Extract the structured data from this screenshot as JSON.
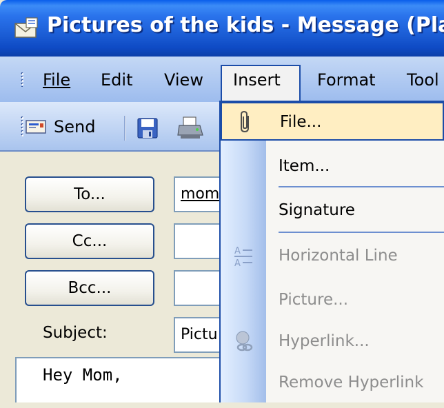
{
  "window": {
    "title": "Pictures of the kids - Message (Plai",
    "title_icon": "envelope-icon"
  },
  "menubar": {
    "items": [
      {
        "label": "File",
        "underline_char": "F"
      },
      {
        "label": "Edit",
        "underline_char": "E"
      },
      {
        "label": "View",
        "underline_char": "V"
      },
      {
        "label": "Insert",
        "underline_char": "I",
        "active": true
      },
      {
        "label": "Format",
        "underline_char": "o"
      },
      {
        "label": "Tool",
        "underline_char": "T"
      }
    ]
  },
  "toolbar": {
    "send_label": "Send",
    "send_icon": "send-envelope-icon",
    "save_icon": "save-icon",
    "print_icon": "print-icon"
  },
  "form": {
    "to_button": "To...",
    "cc_button": "Cc...",
    "bcc_button": "Bcc...",
    "to_value": "mom",
    "cc_value": "",
    "bcc_value": "",
    "subject_label": "Subject:",
    "subject_value": "Pictu",
    "body_text": "Hey Mom,"
  },
  "insert_menu": {
    "items": [
      {
        "label": "File...",
        "disabled": false,
        "highlighted": true,
        "icon": "paperclip-icon"
      },
      {
        "label": "Item...",
        "disabled": false
      },
      {
        "label": "Signature",
        "disabled": false
      },
      {
        "label": "Horizontal Line",
        "disabled": true,
        "icon": "horizontal-line-icon"
      },
      {
        "label": "Picture...",
        "disabled": true
      },
      {
        "label": "Hyperlink...",
        "disabled": true,
        "icon": "hyperlink-icon"
      },
      {
        "label": "Remove Hyperlink",
        "disabled": true
      }
    ]
  },
  "colors": {
    "titlebar": "#0A5EEB",
    "menu_highlight": "#FFEEC2",
    "menu_border": "#1B4CA8",
    "disabled_text": "#8D8D8D",
    "window_bg": "#ECE9D8"
  }
}
